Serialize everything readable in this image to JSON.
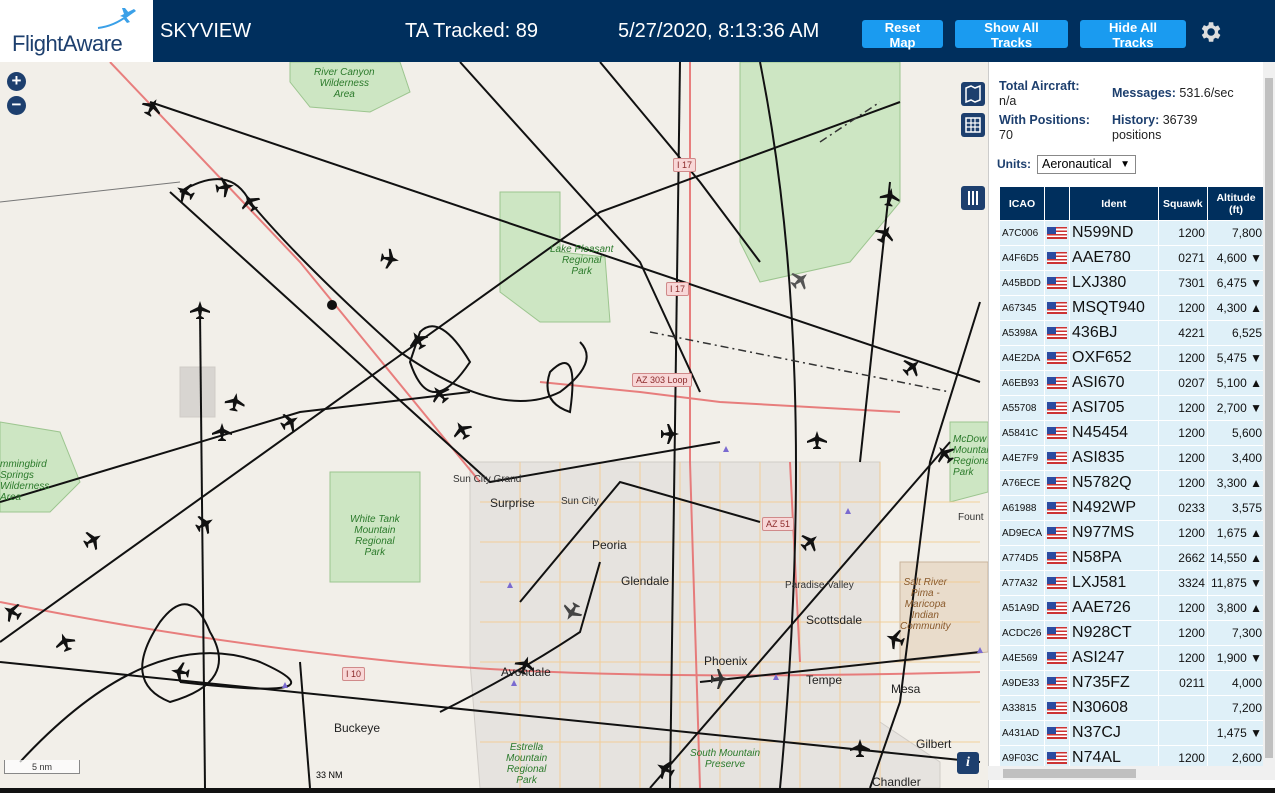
{
  "header": {
    "logo_text": "FlightAware",
    "app_title": "SKYVIEW",
    "ta_tracked": "TA Tracked: 89",
    "clock": "5/27/2020, 8:13:36 AM",
    "buttons": {
      "reset": "Reset Map",
      "show_all": "Show All Tracks",
      "hide_all": "Hide All Tracks"
    },
    "settings_icon": "gear-icon"
  },
  "map": {
    "zoom_in": "+",
    "zoom_out": "−",
    "scale_km": "5 nm",
    "scale_nm": "33 NM",
    "info": "i",
    "labels": {
      "river_canyon": "River Canyon\nWilderness\nArea",
      "lake_pleasant": "Lake Pleasant\nRegional\nPark",
      "white_tank": "White Tank\nMountain\nRegional\nPark",
      "hummingbird": "mmingbird\nSprings\nWilderness\nArea",
      "mcdowell": "McDow\nMountai\nRegional\nPark",
      "estrella": "Estrella\nMountain\nRegional\nPark",
      "south_mountain": "South Mountain\nPreserve",
      "salt_river": "Salt River\nPima -\nMaricopa\nIndian\nCommunity",
      "sun_city_grand": "Sun City Grand",
      "surprise": "Surprise",
      "sun_city": "Sun City",
      "peoria": "Peoria",
      "glendale": "Glendale",
      "paradise_valley": "Paradise Valley",
      "scottsdale": "Scottsdale",
      "phoenix": "Phoenix",
      "tempe": "Tempe",
      "mesa": "Mesa",
      "avondale": "Avondale",
      "buckeye": "Buckeye",
      "gilbert": "Gilbert",
      "chandler": "Chandler",
      "fountain": "Fount"
    },
    "shields": {
      "i17a": "I 17",
      "i17b": "I 17",
      "az303": "AZ 303 Loop",
      "az51": "AZ 51",
      "i10": "I 10"
    }
  },
  "stats": {
    "total_aircraft_label": "Total Aircraft:",
    "total_aircraft_value": "n/a",
    "with_positions_label": "With Positions:",
    "with_positions_value": "70",
    "messages_label": "Messages:",
    "messages_value": "531.6/sec",
    "history_label": "History:",
    "history_value": "36739",
    "history_unit": "positions",
    "units_label": "Units:",
    "units_value": "Aeronautical"
  },
  "table": {
    "headers": {
      "icao": "ICAO",
      "flag": "",
      "ident": "Ident",
      "squawk": "Squawk",
      "altitude": "Altitude (ft)"
    },
    "rows": [
      {
        "icao": "A7C006",
        "ident": "N599ND",
        "squawk": "1200",
        "alt": "7,800"
      },
      {
        "icao": "A4F6D5",
        "ident": "AAE780",
        "squawk": "0271",
        "alt": "4,600 ▼"
      },
      {
        "icao": "A45BDD",
        "ident": "LXJ380",
        "squawk": "7301",
        "alt": "6,475 ▼"
      },
      {
        "icao": "A67345",
        "ident": "MSQT940",
        "squawk": "1200",
        "alt": "4,300 ▲"
      },
      {
        "icao": "A5398A",
        "ident": "436BJ",
        "squawk": "4221",
        "alt": "6,525"
      },
      {
        "icao": "A4E2DA",
        "ident": "OXF652",
        "squawk": "1200",
        "alt": "5,475 ▼"
      },
      {
        "icao": "A6EB93",
        "ident": "ASI670",
        "squawk": "0207",
        "alt": "5,100 ▲"
      },
      {
        "icao": "A55708",
        "ident": "ASI705",
        "squawk": "1200",
        "alt": "2,700 ▼"
      },
      {
        "icao": "A5841C",
        "ident": "N45454",
        "squawk": "1200",
        "alt": "5,600"
      },
      {
        "icao": "A4E7F9",
        "ident": "ASI835",
        "squawk": "1200",
        "alt": "3,400"
      },
      {
        "icao": "A76ECE",
        "ident": "N5782Q",
        "squawk": "1200",
        "alt": "3,300 ▲"
      },
      {
        "icao": "A61988",
        "ident": "N492WP",
        "squawk": "0233",
        "alt": "3,575"
      },
      {
        "icao": "AD9ECA",
        "ident": "N977MS",
        "squawk": "1200",
        "alt": "1,675 ▲"
      },
      {
        "icao": "A774D5",
        "ident": "N58PA",
        "squawk": "2662",
        "alt": "14,550 ▲"
      },
      {
        "icao": "A77A32",
        "ident": "LXJ581",
        "squawk": "3324",
        "alt": "11,875 ▼"
      },
      {
        "icao": "A51A9D",
        "ident": "AAE726",
        "squawk": "1200",
        "alt": "3,800 ▲"
      },
      {
        "icao": "ACDC26",
        "ident": "N928CT",
        "squawk": "1200",
        "alt": "7,300"
      },
      {
        "icao": "A4E569",
        "ident": "ASI247",
        "squawk": "1200",
        "alt": "1,900 ▼"
      },
      {
        "icao": "A9DE33",
        "ident": "N735FZ",
        "squawk": "0211",
        "alt": "4,000"
      },
      {
        "icao": "A33815",
        "ident": "N30608",
        "squawk": "",
        "alt": "7,200"
      },
      {
        "icao": "A431AD",
        "ident": "N37CJ",
        "squawk": "",
        "alt": "1,475 ▼"
      },
      {
        "icao": "A9F03C",
        "ident": "N74AL",
        "squawk": "1200",
        "alt": "2,600"
      }
    ]
  },
  "colors": {
    "header_bg": "#002f5d",
    "button_bg": "#1a9bf0",
    "row_bg": "#dff0f8",
    "park_green": "#cde6c3"
  }
}
